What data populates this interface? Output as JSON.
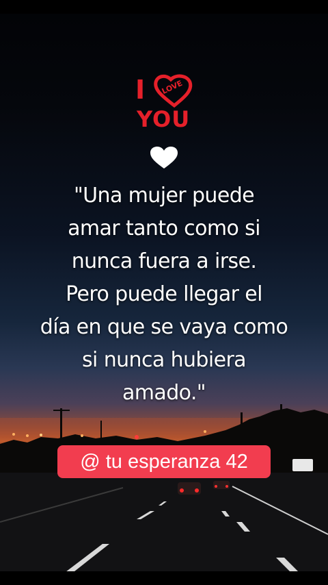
{
  "logo": {
    "line1": "I",
    "heart_text": "LOVE",
    "line2": "YOU",
    "color": "#e5202a"
  },
  "divider_icon": "white-heart-icon",
  "quote": {
    "lines": [
      "\"Una mujer puede",
      "amar tanto como si",
      "nunca fuera a irse.",
      "Pero puede llegar el",
      "día en que se vaya como",
      "si nunca hubiera",
      "amado.\""
    ]
  },
  "username_tag": {
    "text": "@ tu esperanza 42",
    "background": "#f23d4f"
  }
}
